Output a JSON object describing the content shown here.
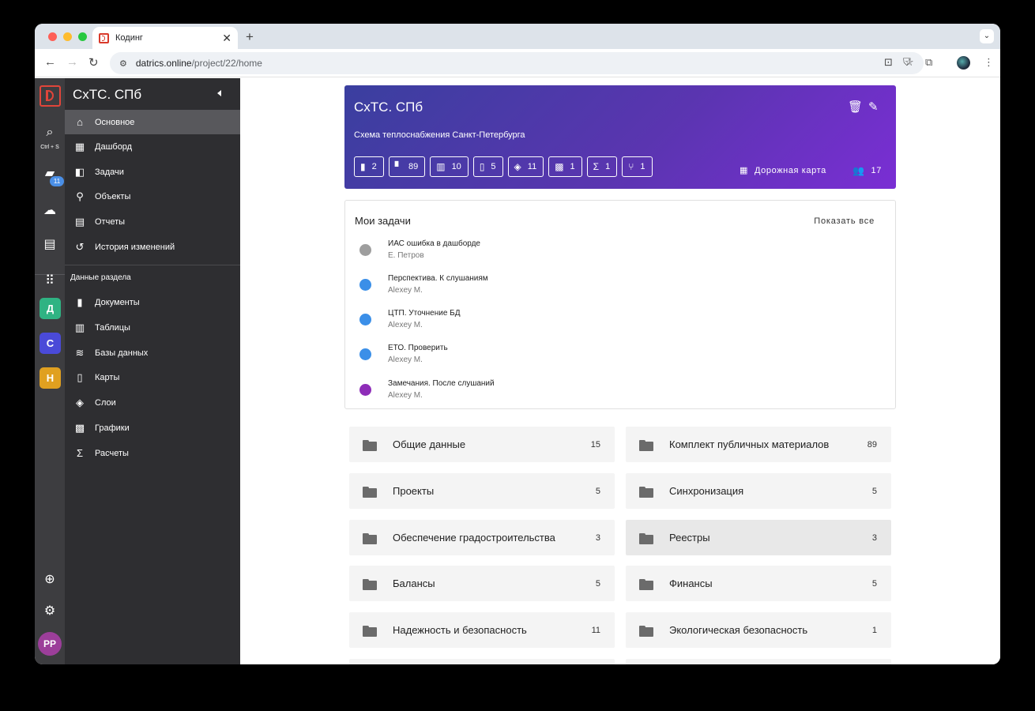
{
  "browser": {
    "tab_title": "Кодинг",
    "url_host": "datrics.online",
    "url_path": "/project/22/home"
  },
  "rail": {
    "search_hint": "Ctrl + S",
    "notifications_badge": "11",
    "projects": [
      {
        "letter": "Д",
        "color": "#2fb383"
      },
      {
        "letter": "С",
        "color": "#4a4ad8"
      },
      {
        "letter": "Н",
        "color": "#e0a020"
      }
    ],
    "avatar_initials": "PP"
  },
  "sidebar": {
    "project_title": "СхТС. СПб",
    "main_items": [
      {
        "label": "Основное",
        "icon": "home-icon",
        "active": true
      },
      {
        "label": "Дашборд",
        "icon": "dashboard-icon"
      },
      {
        "label": "Задачи",
        "icon": "tasks-icon"
      },
      {
        "label": "Объекты",
        "icon": "location-icon"
      },
      {
        "label": "Отчеты",
        "icon": "report-icon"
      },
      {
        "label": "История изменений",
        "icon": "history-icon"
      }
    ],
    "section_title": "Данные раздела",
    "data_items": [
      {
        "label": "Документы",
        "icon": "document-icon"
      },
      {
        "label": "Таблицы",
        "icon": "table-icon"
      },
      {
        "label": "Базы данных",
        "icon": "database-icon"
      },
      {
        "label": "Карты",
        "icon": "map-icon"
      },
      {
        "label": "Слои",
        "icon": "layers-icon"
      },
      {
        "label": "Графики",
        "icon": "chart-icon"
      },
      {
        "label": "Расчеты",
        "icon": "sigma-icon"
      }
    ]
  },
  "hero": {
    "title": "СхТС. СПб",
    "subtitle": "Схема теплоснабжения Санкт-Петербурга",
    "chips": [
      {
        "icon": "document-icon",
        "count": "2"
      },
      {
        "icon": "book-icon",
        "count": "89"
      },
      {
        "icon": "table-icon",
        "count": "10"
      },
      {
        "icon": "map-icon",
        "count": "5"
      },
      {
        "icon": "layers-icon",
        "count": "11"
      },
      {
        "icon": "chart-icon",
        "count": "1"
      },
      {
        "icon": "sigma-icon",
        "count": "1"
      },
      {
        "icon": "fork-icon",
        "count": "1"
      }
    ],
    "roadmap_label": "Дорожная карта",
    "members_count": "17"
  },
  "tasks": {
    "title": "Мои задачи",
    "show_all": "Показать все",
    "items": [
      {
        "name": "ИАС ошибка в дашборде",
        "user": "Е. Петров",
        "status_color": "#9e9e9e"
      },
      {
        "name": "Перспектива. К слушаниям",
        "user": "Alexey M.",
        "status_color": "#3b8fe8"
      },
      {
        "name": "ЦТП. Уточнение БД",
        "user": "Alexey M.",
        "status_color": "#3b8fe8"
      },
      {
        "name": "ЕТО. Проверить",
        "user": "Alexey M.",
        "status_color": "#3b8fe8"
      },
      {
        "name": "Замечания. После слушаний",
        "user": "Alexey M.",
        "status_color": "#8e2db8"
      }
    ]
  },
  "folders": [
    {
      "name": "Общие данные",
      "count": "15"
    },
    {
      "name": "Комплект публичных материалов",
      "count": "89"
    },
    {
      "name": "Проекты",
      "count": "5"
    },
    {
      "name": "Синхронизация",
      "count": "5"
    },
    {
      "name": "Обеспечение градостроительства",
      "count": "3"
    },
    {
      "name": "Реестры",
      "count": "3"
    },
    {
      "name": "Балансы",
      "count": "5"
    },
    {
      "name": "Финансы",
      "count": "5"
    },
    {
      "name": "Надежность и безопасность",
      "count": "11"
    },
    {
      "name": "Экологическая безопасность",
      "count": "1"
    }
  ]
}
